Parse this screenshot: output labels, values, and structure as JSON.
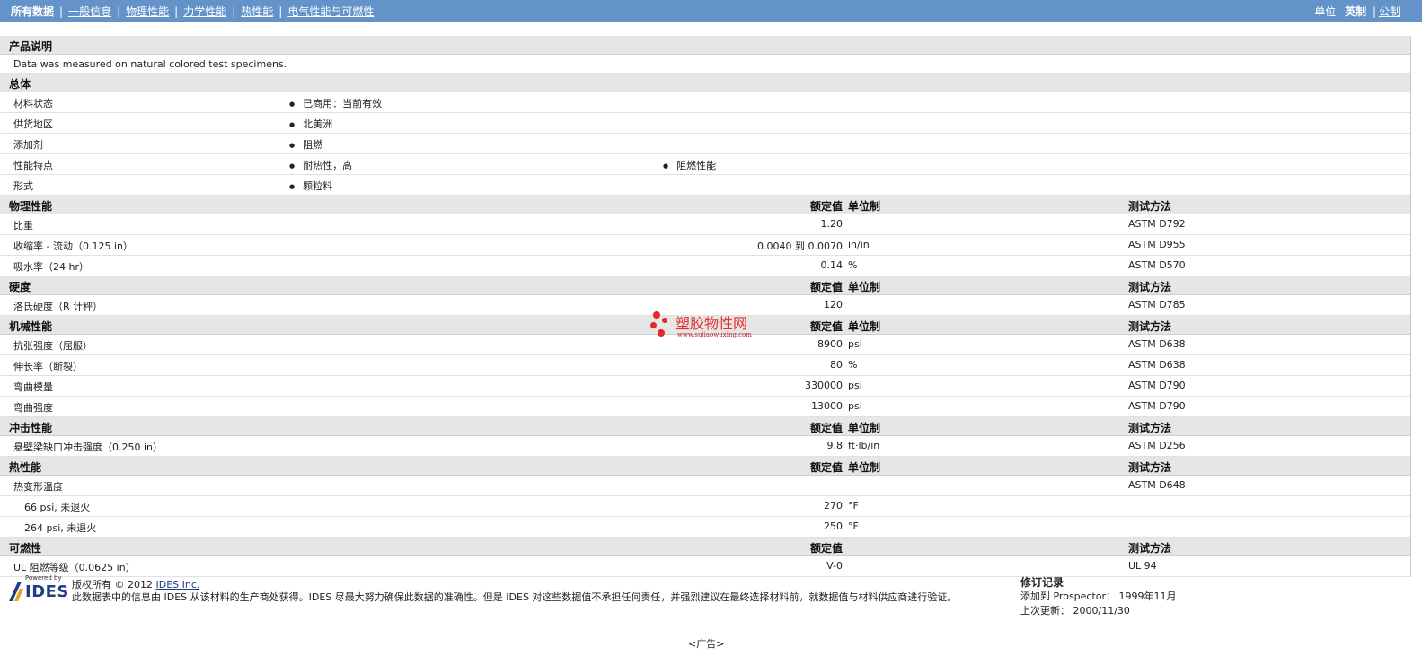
{
  "nav": {
    "items": [
      "所有数据",
      "一般信息",
      "物理性能",
      "力学性能",
      "热性能",
      "电气性能与可燃性"
    ],
    "units_label": "单位",
    "unit_imperial": "英制",
    "unit_metric": "公制"
  },
  "product_note": {
    "title": "产品说明",
    "text": "Data was measured on natural colored test specimens."
  },
  "general": {
    "title": "总体",
    "rows": [
      {
        "label": "材料状态",
        "b1": "已商用：当前有效",
        "b2": ""
      },
      {
        "label": "供货地区",
        "b1": "北美洲",
        "b2": ""
      },
      {
        "label": "添加剂",
        "b1": "阻燃",
        "b2": ""
      },
      {
        "label": "性能特点",
        "b1": "耐热性，高",
        "b2": "阻燃性能"
      },
      {
        "label": "形式",
        "b1": "颗粒料",
        "b2": ""
      }
    ]
  },
  "col_headers": {
    "value": "额定值",
    "unit": "单位制",
    "method": "测试方法"
  },
  "physical": {
    "title": "物理性能",
    "rows": [
      {
        "label": "比重",
        "value": "1.20",
        "unit": "",
        "method": "ASTM D792"
      },
      {
        "label": "收缩率 - 流动（0.125 in）",
        "value": "0.0040 到  0.0070",
        "unit": "in/in",
        "method": "ASTM D955"
      },
      {
        "label": "吸水率（24 hr）",
        "value": "0.14",
        "unit": "%",
        "method": "ASTM D570"
      }
    ]
  },
  "hardness": {
    "title": "硬度",
    "rows": [
      {
        "label": "洛氏硬度（R 计秤）",
        "value": "120",
        "unit": "",
        "method": "ASTM D785"
      }
    ]
  },
  "mechanical": {
    "title": "机械性能",
    "rows": [
      {
        "label": "抗张强度（屈服）",
        "value": "8900",
        "unit": "psi",
        "method": "ASTM D638"
      },
      {
        "label": "伸长率（断裂）",
        "value": "80",
        "unit": "%",
        "method": "ASTM D638"
      },
      {
        "label": "弯曲模量",
        "value": "330000",
        "unit": "psi",
        "method": "ASTM D790"
      },
      {
        "label": "弯曲强度",
        "value": "13000",
        "unit": "psi",
        "method": "ASTM D790"
      }
    ]
  },
  "impact": {
    "title": "冲击性能",
    "rows": [
      {
        "label": "悬壁梁缺口冲击强度（0.250 in）",
        "value": "9.8",
        "unit": "ft·lb/in",
        "method": "ASTM D256"
      }
    ]
  },
  "thermal": {
    "title": "热性能",
    "rows": [
      {
        "label": "热变形温度",
        "value": "",
        "unit": "",
        "method": "ASTM D648"
      },
      {
        "label": "66 psi, 未退火",
        "value": "270",
        "unit": "°F",
        "method": ""
      },
      {
        "label": "264 psi, 未退火",
        "value": "250",
        "unit": "°F",
        "method": ""
      }
    ]
  },
  "flammability": {
    "title": "可燃性",
    "rows": [
      {
        "label": "UL 阻燃等级（0.0625 in）",
        "value": "V-0",
        "unit": "",
        "method": "UL 94"
      }
    ]
  },
  "watermark": {
    "title": "塑胶物性网",
    "url": "www.sujiaowuxing.com"
  },
  "footer": {
    "logo_powered": "Powered by",
    "logo_name": "IDES",
    "copyright": "版权所有 © 2012 ",
    "copyright_link": "IDES Inc.",
    "disclaimer": "此数据表中的信息由 IDES 从该材料的生产商处获得。IDES 尽最大努力确保此数据的准确性。但是 IDES 对这些数据值不承担任何责任，并强烈建议在最终选择材料前，就数据值与材料供应商进行验证。",
    "rev_title": "修订记录",
    "rev_added": "添加到 Prospector： 1999年11月",
    "rev_updated": "上次更新： 2000/11/30"
  },
  "ad_label": "<广告>"
}
